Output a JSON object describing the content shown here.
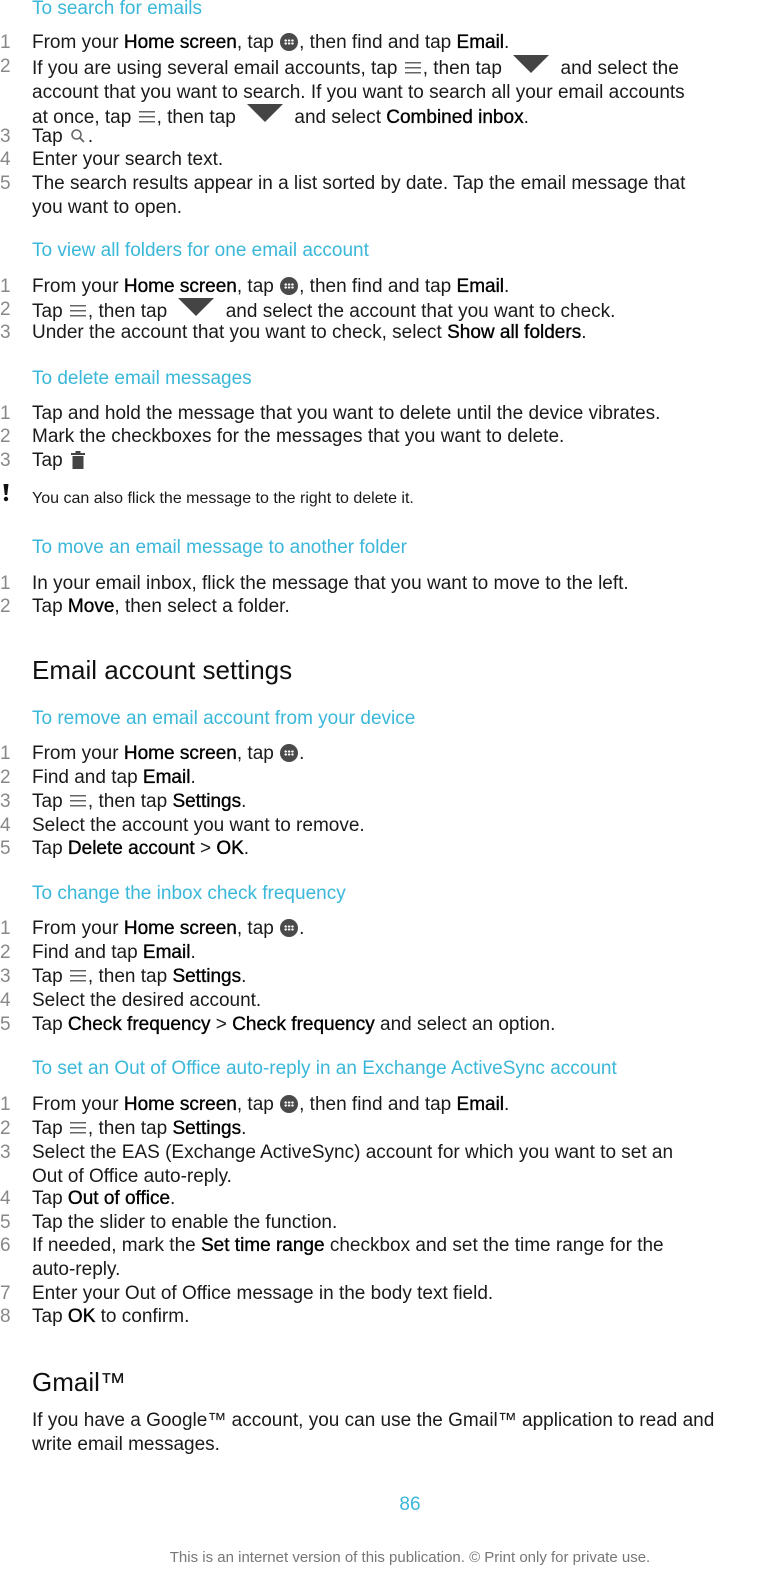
{
  "colors": {
    "subheading": "#3ab7d9",
    "body_text": "#1a1a1a",
    "step_number": "#888888",
    "footer": "#777777"
  },
  "sections": {
    "search": {
      "title": "To search for emails",
      "steps": [
        {
          "n": "1",
          "a": "From your ",
          "b1": "Home screen",
          "c": ", tap ",
          "icon": "apps-icon",
          "d": ", then find and tap ",
          "b2": "Email",
          "e": "."
        },
        {
          "n": "2",
          "l1a": "If you are using several email accounts, tap ",
          "icon1": "menu-icon",
          "l1b": ", then tap ",
          "icon2": "dropdown-triangle-icon",
          "l1c": " and select the",
          "l2": "account that you want to search. If you want to search all your email accounts",
          "l3a": "at once, tap ",
          "icon3": "menu-icon",
          "l3b": ", then tap ",
          "icon4": "dropdown-triangle-icon",
          "l3c": " and select ",
          "b": "Combined inbox",
          "end": "."
        },
        {
          "n": "3",
          "a": "Tap ",
          "icon": "search-icon",
          "end": "."
        },
        {
          "n": "4",
          "text": "Enter your search text."
        },
        {
          "n": "5",
          "l1": "The search results appear in a list sorted by date. Tap the email message that",
          "l2": "you want to open."
        }
      ]
    },
    "folders": {
      "title": "To view all folders for one email account",
      "steps": [
        {
          "n": "1",
          "a": "From your ",
          "b1": "Home screen",
          "c": ", tap ",
          "icon": "apps-icon",
          "d": ", then find and tap ",
          "b2": "Email",
          "e": "."
        },
        {
          "n": "2",
          "a": "Tap ",
          "icon1": "menu-icon",
          "b": ", then tap ",
          "icon2": "dropdown-triangle-icon",
          "c": " and select the account that you want to check."
        },
        {
          "n": "3",
          "a": "Under the account that you want to check, select ",
          "b": "Show all folders",
          "end": "."
        }
      ]
    },
    "delete": {
      "title": "To delete email messages",
      "steps": [
        {
          "n": "1",
          "text": "Tap and hold the message that you want to delete until the device vibrates."
        },
        {
          "n": "2",
          "text": "Mark the checkboxes for the messages that you want to delete."
        },
        {
          "n": "3",
          "a": "Tap ",
          "icon": "trash-icon"
        }
      ],
      "note": "You can also flick the message to the right to delete it."
    },
    "move": {
      "title": "To move an email message to another folder",
      "steps": [
        {
          "n": "1",
          "text": "In your email inbox, flick the message that you want to move to the left."
        },
        {
          "n": "2",
          "a": "Tap ",
          "b": "Move",
          "c": ", then select a folder."
        }
      ]
    },
    "settings_heading": "Email account settings",
    "remove": {
      "title": "To remove an email account from your device",
      "steps": [
        {
          "n": "1",
          "a": "From your ",
          "b": "Home screen",
          "c": ", tap ",
          "icon": "apps-icon",
          "end": "."
        },
        {
          "n": "2",
          "a": "Find and tap ",
          "b": "Email",
          "end": "."
        },
        {
          "n": "3",
          "a": "Tap ",
          "icon": "menu-icon",
          "c": ", then tap ",
          "b": "Settings",
          "end": "."
        },
        {
          "n": "4",
          "text": "Select the account you want to remove."
        },
        {
          "n": "5",
          "a": "Tap ",
          "b1": "Delete account",
          "sep": " > ",
          "b2": "OK",
          "end": "."
        }
      ]
    },
    "frequency": {
      "title": "To change the inbox check frequency",
      "steps": [
        {
          "n": "1",
          "a": "From your ",
          "b": "Home screen",
          "c": ", tap ",
          "icon": "apps-icon",
          "end": "."
        },
        {
          "n": "2",
          "a": "Find and tap ",
          "b": "Email",
          "end": "."
        },
        {
          "n": "3",
          "a": "Tap ",
          "icon": "menu-icon",
          "c": ", then tap ",
          "b": "Settings",
          "end": "."
        },
        {
          "n": "4",
          "text": "Select the desired account."
        },
        {
          "n": "5",
          "a": "Tap ",
          "b1": "Check frequency",
          "sep": " > ",
          "b2": "Check frequency",
          "end": " and select an option."
        }
      ]
    },
    "ooo": {
      "title": "To set an Out of Office auto-reply in an Exchange ActiveSync account",
      "steps": [
        {
          "n": "1",
          "a": "From your ",
          "b1": "Home screen",
          "c": ", tap ",
          "icon": "apps-icon",
          "d": ", then find and tap ",
          "b2": "Email",
          "e": "."
        },
        {
          "n": "2",
          "a": "Tap ",
          "icon": "menu-icon",
          "c": ", then tap ",
          "b": "Settings",
          "end": "."
        },
        {
          "n": "3",
          "l1": "Select the EAS (Exchange ActiveSync) account for which you want to set an",
          "l2": "Out of Office auto-reply."
        },
        {
          "n": "4",
          "a": "Tap ",
          "b": "Out of office",
          "end": "."
        },
        {
          "n": "5",
          "text": "Tap the slider to enable the function."
        },
        {
          "n": "6",
          "a": "If needed, mark the ",
          "b": "Set time range",
          "c": " checkbox and set the time range for the",
          "l2": "auto-reply."
        },
        {
          "n": "7",
          "text": "Enter your Out of Office message in the body text field."
        },
        {
          "n": "8",
          "a": "Tap ",
          "b": "OK",
          "c": " to confirm."
        }
      ]
    },
    "gmail": {
      "heading": "Gmail™",
      "l1": "If you have a Google™ account, you can use the Gmail™ application to read and",
      "l2": "write email messages."
    }
  },
  "page_number": "86",
  "footer": "This is an internet version of this publication. © Print only for private use."
}
